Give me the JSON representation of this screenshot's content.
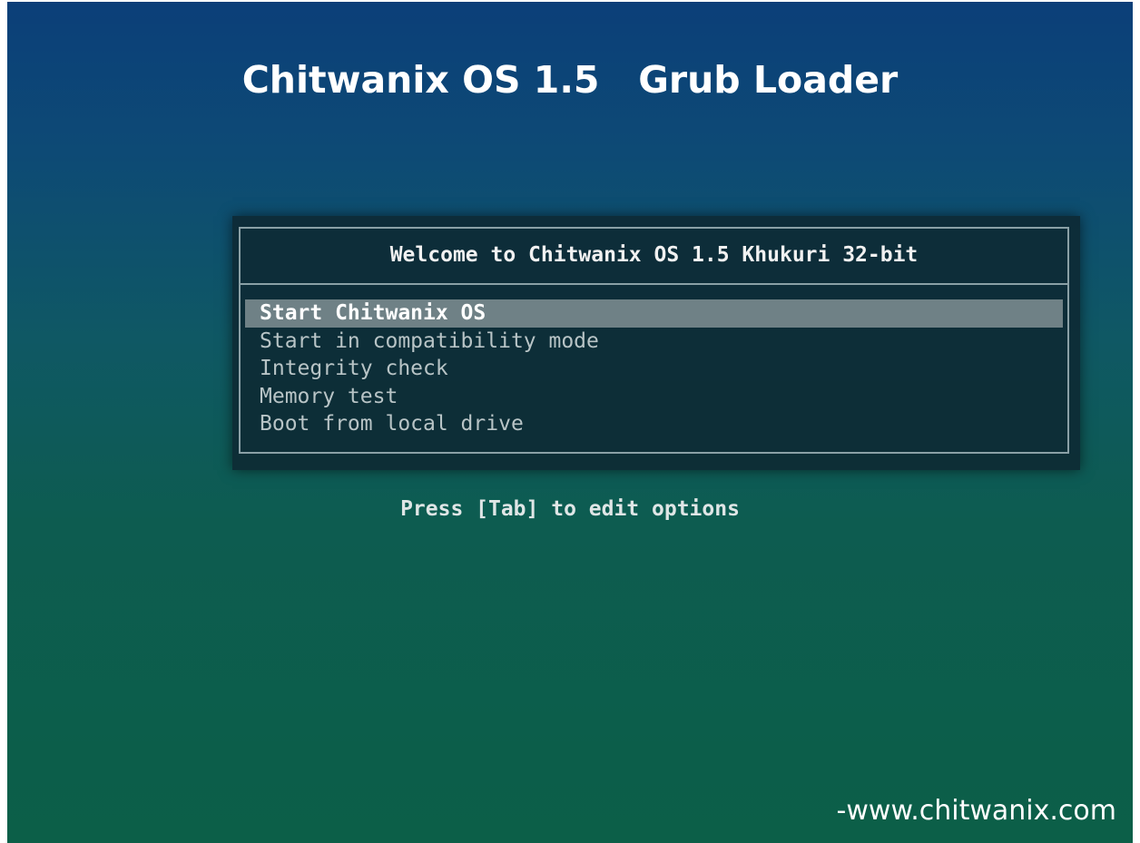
{
  "title": "Chitwanix OS 1.5   Grub Loader",
  "menu": {
    "header": "Welcome to Chitwanix OS 1.5 Khukuri 32-bit",
    "selected_index": 0,
    "items": [
      {
        "label": "Start Chitwanix OS"
      },
      {
        "label": "Start in compatibility mode"
      },
      {
        "label": "Integrity check"
      },
      {
        "label": "Memory test"
      },
      {
        "label": "Boot from local drive"
      }
    ]
  },
  "hint": "Press [Tab] to edit options",
  "footer": {
    "url": "-www.chitwanix.com"
  },
  "colors": {
    "background_top": "#0c3f79",
    "background_bottom": "#0c5f48",
    "selection": "#6f8186"
  }
}
